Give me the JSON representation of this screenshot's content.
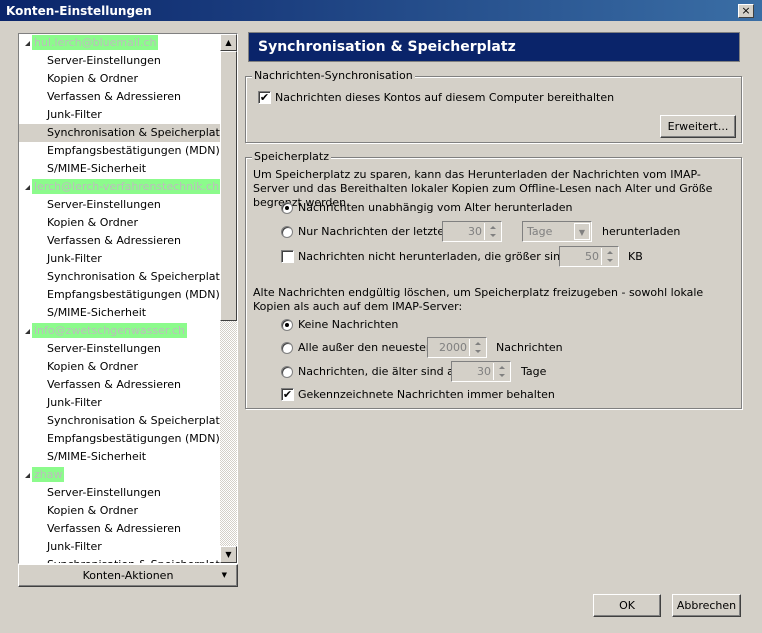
{
  "window": {
    "title": "Konten-Einstellungen",
    "close": "×"
  },
  "tree": {
    "accounts": [
      {
        "name": "hul.lerch@bluemail.ch",
        "items": [
          "Server-Einstellungen",
          "Kopien & Ordner",
          "Verfassen & Adressieren",
          "Junk-Filter",
          "Synchronisation & Speicherplatz",
          "Empfangsbestätigungen (MDN)",
          "S/MIME-Sicherheit"
        ],
        "selected": 4
      },
      {
        "name": "lerch@lerch-verfahrenstechnik.ch",
        "items": [
          "Server-Einstellungen",
          "Kopien & Ordner",
          "Verfassen & Adressieren",
          "Junk-Filter",
          "Synchronisation & Speicherplatz",
          "Empfangsbestätigungen (MDN)",
          "S/MIME-Sicherheit"
        ]
      },
      {
        "name": "info@zwetschgenwasser.ch",
        "items": [
          "Server-Einstellungen",
          "Kopien & Ordner",
          "Verfassen & Adressieren",
          "Junk-Filter",
          "Synchronisation & Speicherplatz",
          "Empfangsbestätigungen (MDN)",
          "S/MIME-Sicherheit"
        ]
      },
      {
        "name": "zhaw",
        "items": [
          "Server-Einstellungen",
          "Kopien & Ordner",
          "Verfassen & Adressieren",
          "Junk-Filter",
          "Synchronisation & Speicherplatz"
        ]
      }
    ]
  },
  "account_actions": "Konten-Aktionen",
  "panel": {
    "title": "Synchronisation & Speicherplatz",
    "sync": {
      "legend": "Nachrichten-Synchronisation",
      "keep_label": "Nachrichten dieses Kontos auf diesem Computer bereithalten",
      "keep_checked": true,
      "advanced": "Erweitert..."
    },
    "storage": {
      "legend": "Speicherplatz",
      "desc": "Um Speicherplatz zu sparen, kann das Herunterladen der Nachrichten vom IMAP-Server und das Bereithalten lokaler Kopien zum Offline-Lesen nach Alter und Größe begrenzt werden.",
      "opt_all": "Nachrichten unabhängig vom Alter herunterladen",
      "opt_last": "Nur Nachrichten der letzten",
      "last_value": "30",
      "last_unit": "Tage",
      "last_suffix": "herunterladen",
      "size_label": "Nachrichten nicht herunterladen, die größer sind als",
      "size_value": "50",
      "size_unit": "KB",
      "delete_desc": "Alte Nachrichten endgültig löschen, um Speicherplatz freizugeben - sowohl lokale Kopien als auch auf dem IMAP-Server:",
      "del_none": "Keine Nachrichten",
      "del_all_but": "Alle außer den neuesten",
      "all_but_value": "2000",
      "all_but_suffix": "Nachrichten",
      "del_older": "Nachrichten, die älter sind als",
      "older_value": "30",
      "older_suffix": "Tage",
      "keep_flagged": "Gekennzeichnete Nachrichten immer behalten"
    }
  },
  "buttons": {
    "ok": "OK",
    "cancel": "Abbrechen"
  }
}
